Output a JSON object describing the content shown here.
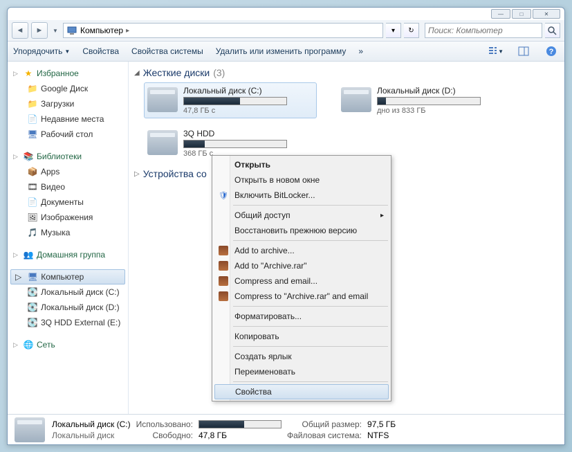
{
  "address": {
    "location": "Компьютер"
  },
  "search": {
    "placeholder": "Поиск: Компьютер"
  },
  "toolbar": {
    "organize": "Упорядочить",
    "properties": "Свойства",
    "sys_properties": "Свойства системы",
    "uninstall": "Удалить или изменить программу",
    "overflow": "»"
  },
  "sidebar": {
    "favorites": {
      "label": "Избранное",
      "items": [
        "Google Диск",
        "Загрузки",
        "Недавние места",
        "Рабочий стол"
      ]
    },
    "libraries": {
      "label": "Библиотеки",
      "items": [
        "Apps",
        "Видео",
        "Документы",
        "Изображения",
        "Музыка"
      ]
    },
    "homegroup": "Домашняя группа",
    "computer": {
      "label": "Компьютер",
      "items": [
        "Локальный диск (C:)",
        "Локальный диск (D:)",
        "3Q HDD External (E:)"
      ]
    },
    "network": "Сеть"
  },
  "sections": {
    "hdd": {
      "label": "Жесткие диски",
      "count": "(3)"
    },
    "removable": "Устройства со"
  },
  "drives": {
    "c": {
      "name": "Локальный диск (C:)",
      "free": "47,8 ГБ с",
      "fill": 55
    },
    "d": {
      "name": "Локальный диск (D:)",
      "free": "дно из 833 ГБ",
      "fill": 8
    },
    "e": {
      "name": "3Q HDD",
      "free": "368 ГБ с",
      "fill": 20
    }
  },
  "context": {
    "open": "Открыть",
    "open_new": "Открыть в новом окне",
    "bitlocker": "Включить BitLocker...",
    "share": "Общий доступ",
    "restore": "Восстановить прежнюю версию",
    "add_archive": "Add to archive...",
    "add_rar": "Add to \"Archive.rar\"",
    "compress_email": "Compress and email...",
    "compress_rar_email": "Compress to \"Archive.rar\" and email",
    "format": "Форматировать...",
    "copy": "Копировать",
    "shortcut": "Создать ярлык",
    "rename": "Переименовать",
    "props": "Свойства"
  },
  "status": {
    "name": "Локальный диск (C:)",
    "type": "Локальный диск",
    "used_label": "Использовано:",
    "free_label": "Свободно:",
    "free_value": "47,8 ГБ",
    "total_label": "Общий размер:",
    "total_value": "97,5 ГБ",
    "fs_label": "Файловая система:",
    "fs_value": "NTFS",
    "fill": 55
  }
}
